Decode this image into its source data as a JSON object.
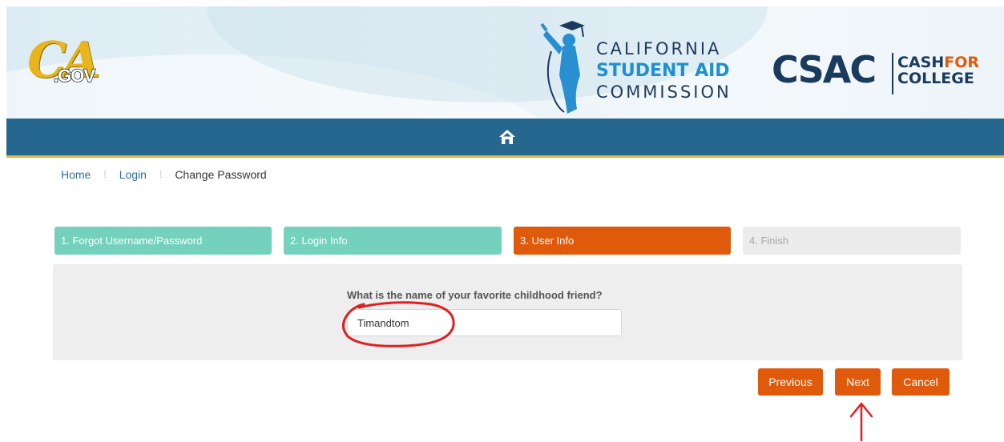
{
  "header": {
    "ca_logo": {
      "ca": "CA",
      "gov": ".GOV"
    },
    "commission": {
      "line1": "CALIFORNIA",
      "line2": "STUDENT AID",
      "line3": "COMMISSION"
    },
    "csac": "CSAC",
    "cash_for_college": {
      "cash": "CASH",
      "for": "FOR",
      "college": "COLLEGE"
    }
  },
  "nav": {
    "home_icon": "home-icon"
  },
  "breadcrumb": {
    "home": "Home",
    "login": "Login",
    "current": "Change Password"
  },
  "steps": [
    {
      "label": "1. Forgot Username/Password",
      "state": "done"
    },
    {
      "label": "2. Login Info",
      "state": "done"
    },
    {
      "label": "3. User Info",
      "state": "active"
    },
    {
      "label": "4. Finish",
      "state": "todo"
    }
  ],
  "form": {
    "question": "What is the name of your favorite childhood friend?",
    "answer_value": "Timandtom"
  },
  "buttons": {
    "previous": "Previous",
    "next": "Next",
    "cancel": "Cancel"
  },
  "colors": {
    "brand_blue": "#266790",
    "accent_orange": "#e05a0c",
    "step_done": "#74d1be",
    "step_todo": "#ececec",
    "annotation_red": "#e02020"
  }
}
